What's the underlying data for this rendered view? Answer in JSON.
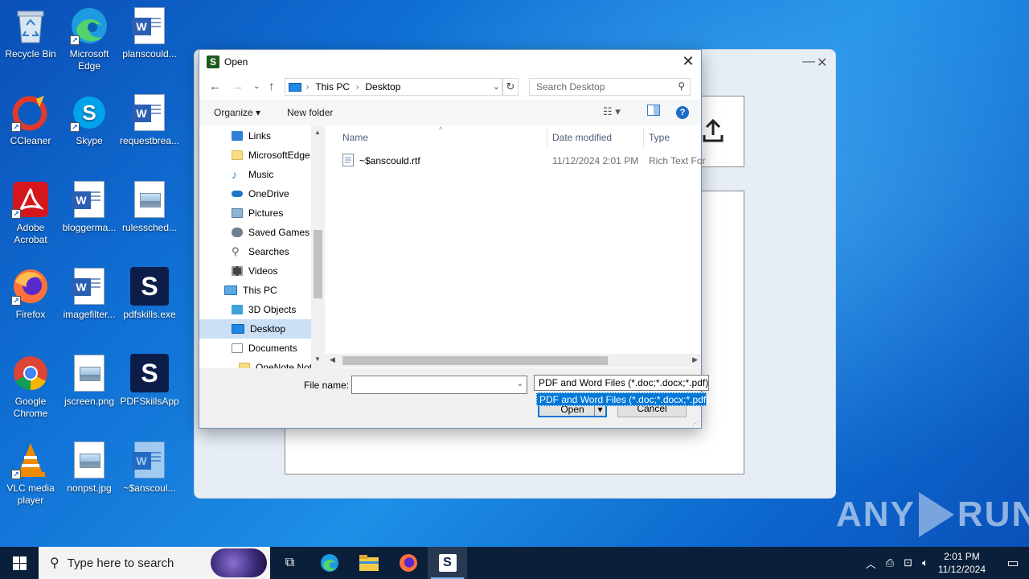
{
  "desktop": {
    "icons": [
      {
        "label": "Recycle Bin",
        "icon": "recycle-bin-icon"
      },
      {
        "label": "Microsoft Edge",
        "icon": "edge-icon"
      },
      {
        "label": "planscould...",
        "icon": "word-doc-icon"
      },
      {
        "label": "CCleaner",
        "icon": "ccleaner-icon"
      },
      {
        "label": "Skype",
        "icon": "skype-icon"
      },
      {
        "label": "requestbrea...",
        "icon": "word-doc-icon"
      },
      {
        "label": "Adobe Acrobat",
        "icon": "acrobat-icon"
      },
      {
        "label": "bloggerma...",
        "icon": "word-doc-icon"
      },
      {
        "label": "rulessched...",
        "icon": "image-file-icon"
      },
      {
        "label": "Firefox",
        "icon": "firefox-icon"
      },
      {
        "label": "imagefilter...",
        "icon": "word-doc-icon"
      },
      {
        "label": "pdfskills.exe",
        "icon": "pdfskills-icon"
      },
      {
        "label": "Google Chrome",
        "icon": "chrome-icon"
      },
      {
        "label": "jscreen.png",
        "icon": "image-file-icon"
      },
      {
        "label": "PDFSkillsApp",
        "icon": "pdfskills-icon"
      },
      {
        "label": "VLC media player",
        "icon": "vlc-icon"
      },
      {
        "label": "nonpst.jpg",
        "icon": "image-file-icon"
      },
      {
        "label": "~$anscoul...",
        "icon": "word-doc-icon"
      }
    ]
  },
  "dialog": {
    "title": "Open",
    "address": {
      "crumb1": "This PC",
      "crumb2": "Desktop"
    },
    "search_placeholder": "Search Desktop",
    "toolbar": {
      "organize": "Organize",
      "new_folder": "New folder"
    },
    "tree": [
      {
        "label": "Links",
        "icon": "links-icon"
      },
      {
        "label": "MicrosoftEdge",
        "icon": "folder-icon"
      },
      {
        "label": "Music",
        "icon": "music-icon"
      },
      {
        "label": "OneDrive",
        "icon": "onedrive-icon"
      },
      {
        "label": "Pictures",
        "icon": "pictures-icon"
      },
      {
        "label": "Saved Games",
        "icon": "saved-games-icon"
      },
      {
        "label": "Searches",
        "icon": "searches-icon"
      },
      {
        "label": "Videos",
        "icon": "videos-icon"
      },
      {
        "label": "This PC",
        "icon": "this-pc-icon"
      },
      {
        "label": "3D Objects",
        "icon": "3d-objects-icon"
      },
      {
        "label": "Desktop",
        "icon": "desktop-icon"
      },
      {
        "label": "Documents",
        "icon": "documents-icon"
      },
      {
        "label": "OneNote Not",
        "icon": "folder-icon"
      }
    ],
    "columns": {
      "name": "Name",
      "date": "Date modified",
      "type": "Type"
    },
    "files": [
      {
        "name": "~$anscould.rtf",
        "date": "11/12/2024 2:01 PM",
        "type": "Rich Text For"
      }
    ],
    "file_name_label": "File name:",
    "file_name_value": "",
    "filter_selected": "PDF and Word Files (*.doc;*.docx;*.pdf)",
    "filter_option": "PDF and Word Files (*.doc;*.docx;*.pdf)",
    "open_label": "Open",
    "cancel_label": "Cancel"
  },
  "taskbar": {
    "search_placeholder": "Type here to search",
    "time": "2:01 PM",
    "date": "11/12/2024"
  },
  "watermark": {
    "left": "ANY",
    "right": "RUN"
  },
  "colors": {
    "accent": "#0078d7",
    "taskbar": "#0a1f3a",
    "selection": "#cce0f5"
  }
}
